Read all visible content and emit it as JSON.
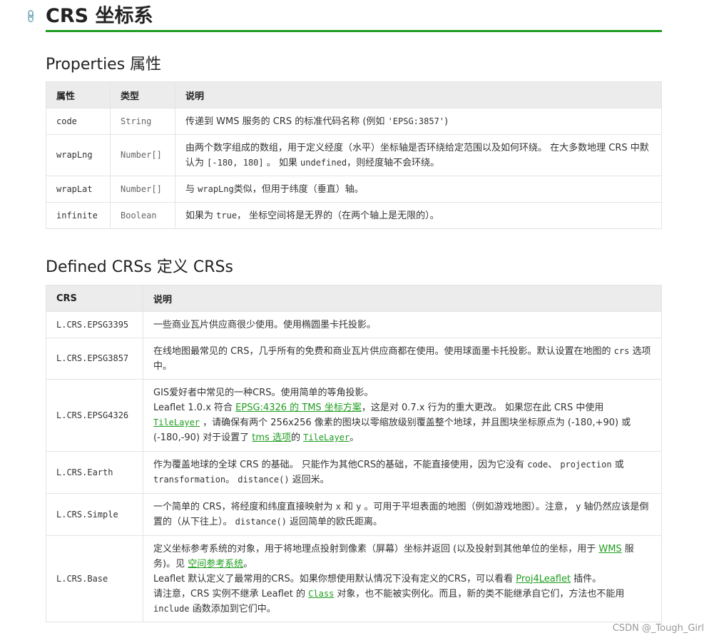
{
  "page": {
    "title": "CRS 坐标系"
  },
  "properties": {
    "heading": "Properties 属性",
    "headers": [
      "属性",
      "类型",
      "说明"
    ],
    "rows": [
      {
        "name": "code",
        "type": "String",
        "desc_a": "传递到 WMS 服务的 CRS 的标准代码名称 (例如 ",
        "desc_code": "'EPSG:3857'",
        "desc_b": ")"
      },
      {
        "name": "wrapLng",
        "type": "Number[]",
        "desc_a": "由两个数字组成的数组，用于定义经度（水平）坐标轴是否环绕给定范围以及如何环绕。 在大多数地理 CRS 中默认为 ",
        "desc_code": "[-180, 180]",
        "desc_b": " 。 如果 ",
        "desc_code2": "undefined",
        "desc_c": "，则经度轴不会环绕。"
      },
      {
        "name": "wrapLat",
        "type": "Number[]",
        "desc_a": "与 ",
        "desc_code": "wrapLng",
        "desc_b": "类似，但用于纬度（垂直）轴。"
      },
      {
        "name": "infinite",
        "type": "Boolean",
        "desc_a": "如果为 ",
        "desc_code": "true",
        "desc_b": "， 坐标空间将是无界的（在两个轴上是无限的）。"
      }
    ]
  },
  "defined": {
    "heading": "Defined CRSs 定义 CRSs",
    "headers": [
      "CRS",
      "说明"
    ],
    "epsg3395": {
      "name": "L.CRS.EPSG3395",
      "desc": "一些商业瓦片供应商很少使用。使用椭圆墨卡托投影。"
    },
    "epsg3857": {
      "name": "L.CRS.EPSG3857",
      "desc_a": "在线地图最常见的 CRS，几乎所有的免费和商业瓦片供应商都在使用。使用球面墨卡托投影。默认设置在地图的 ",
      "desc_code": "crs",
      "desc_b": " 选项中。"
    },
    "epsg4326": {
      "name": "L.CRS.EPSG4326",
      "line1": "GIS爱好者中常见的一种CRS。使用简单的等角投影。",
      "l2a": "Leaflet 1.0.x 符合 ",
      "l2link": "EPSG:4326 的 TMS 坐标方案",
      "l2b": "，这是对 0.7.x 行为的重大更改。 如果您在此 CRS 中使用 ",
      "l2code": "TileLayer",
      "l2c": " ，请确保有两个 256x256 像素的图块以零缩放级别覆盖整个地球，并且图块坐标原点为 (-180,+90) 或 (-180,-90) 对于设置了 ",
      "l2link2": "tms 选项",
      "l2d": "的 ",
      "l2code2": "TileLayer",
      "l2e": "。"
    },
    "earth": {
      "name": "L.CRS.Earth",
      "a": "作为覆盖地球的全球 CRS 的基础。 只能作为其他CRS的基础，不能直接使用，因为它没有 ",
      "c1": "code",
      "b": "、 ",
      "c2": "projection",
      "c": " 或 ",
      "c3": "transformation",
      "d": "。 ",
      "c4": "distance()",
      "e": " 返回米。"
    },
    "simple": {
      "name": "L.CRS.Simple",
      "a": "一个简单的 CRS，将经度和纬度直接映射为 ",
      "c1": "x",
      "b": " 和 ",
      "c2": "y",
      "c": " 。可用于平坦表面的地图（例如游戏地图）。注意， ",
      "c3": "y",
      "d": " 轴仍然应该是倒置的（从下往上）。 ",
      "c4": "distance()",
      "e": " 返回简单的欧氏距离。"
    },
    "base": {
      "name": "L.CRS.Base",
      "a": "定义坐标参考系统的对象，用于将地理点投射到像素（屏幕）坐标并返回 (以及投射到其他单位的坐标，用于 ",
      "link1": "WMS",
      "b": " 服务)。见 ",
      "link2": "空间参考系统",
      "c": "。",
      "d": "Leaflet 默认定义了最常用的CRS。如果你想使用默认情况下没有定义的CRS，可以看看 ",
      "link3": "Proj4Leaflet",
      "e": " 插件。",
      "f": "请注意，CRS 实例不继承 Leaflet 的 ",
      "code1": "Class",
      "g": " 对象，也不能被实例化。而且，新的类不能继承自它们，方法也不能用 ",
      "code2": "include",
      "h": " 函数添加到它们中。"
    }
  },
  "watermark": "CSDN @_Tough_Girl",
  "colors": {
    "accent": "#1f9d1f",
    "header_bg": "#ececec"
  }
}
